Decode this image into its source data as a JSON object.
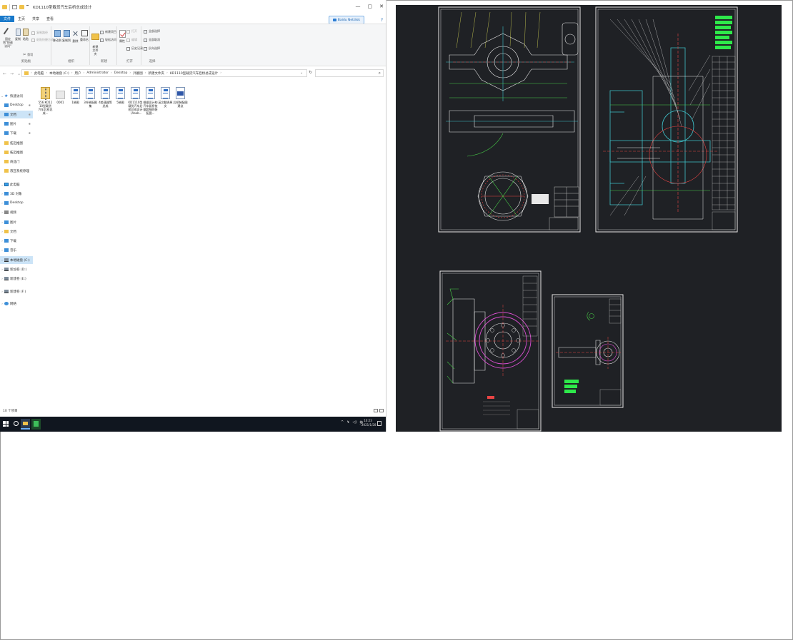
{
  "window": {
    "title": "KD1110型载货汽车后桥总成设计",
    "minimize": "—",
    "maximize": "▢",
    "close": "✕"
  },
  "ribbon": {
    "tabs": [
      "文件",
      "主页",
      "共享",
      "查看"
    ],
    "share_button": "Baidu Netdisk",
    "help": "?",
    "groups": {
      "clipboard": {
        "label": "剪贴板",
        "pin": "固定到\"快速访问\"",
        "copy": "复制",
        "paste": "粘贴",
        "copy_path": "复制路径",
        "paste_shortcut": "粘贴快捷方式",
        "cut": "剪切"
      },
      "organize": {
        "label": "组织",
        "move_to": "移动到",
        "copy_to": "复制到",
        "delete": "删除",
        "rename": "重命名"
      },
      "new": {
        "label": "新建",
        "new_folder": "新建\n文件夹",
        "new_item": "新建项目",
        "easy_access": "轻松访问"
      },
      "open": {
        "label": "打开",
        "properties": "属性",
        "open": "打开",
        "edit": "编辑",
        "history": "历史记录"
      },
      "select": {
        "label": "选择",
        "select_all": "全部选择",
        "select_none": "全部取消",
        "invert": "反向选择"
      }
    }
  },
  "address": {
    "back": "←",
    "forward": "→",
    "recent": "⌄",
    "up": "↑",
    "crumbs": [
      "此电脑",
      "本地磁盘 (C:)",
      "用户",
      "Administrator",
      "Desktop",
      "外翻图",
      "新建文件夹",
      "KD1110型载货汽车后桥总成设计"
    ],
    "separator": "›",
    "dropdown": "⌄",
    "refresh": "↻",
    "search_icon": "⌕"
  },
  "navpane": {
    "items": [
      {
        "label": "快速访问",
        "icon": "star-icon",
        "kind": "star",
        "chev": "⌄",
        "pin": ""
      },
      {
        "label": "Desktop",
        "icon": "desktop-icon",
        "kind": "blue",
        "chev": "",
        "pin": "✱"
      },
      {
        "label": "文档",
        "icon": "documents-icon",
        "kind": "blue",
        "chev": "",
        "pin": "✱"
      },
      {
        "label": "图片",
        "icon": "pictures-icon",
        "kind": "blue",
        "chev": "",
        "pin": "✱"
      },
      {
        "label": "下载",
        "icon": "downloads-icon",
        "kind": "blue",
        "chev": "",
        "pin": "✱"
      },
      {
        "label": "拓迈推图",
        "icon": "folder-icon",
        "kind": "yellow",
        "chev": "",
        "pin": ""
      },
      {
        "label": "拓迈推图",
        "icon": "folder-icon",
        "kind": "yellow",
        "chev": "",
        "pin": ""
      },
      {
        "label": "商品门",
        "icon": "folder-icon",
        "kind": "yellow",
        "chev": "",
        "pin": ""
      },
      {
        "label": "液压系统原理",
        "icon": "folder-icon",
        "kind": "yellow",
        "chev": "",
        "pin": ""
      },
      {
        "label": "此电脑",
        "icon": "computer-icon",
        "kind": "pc",
        "chev": "⌄",
        "pin": ""
      },
      {
        "label": "3D 对象",
        "icon": "3d-objects-icon",
        "kind": "blue",
        "chev": "›",
        "pin": ""
      },
      {
        "label": "Desktop",
        "icon": "desktop-icon",
        "kind": "blue",
        "chev": "›",
        "pin": ""
      },
      {
        "label": "视频",
        "icon": "videos-icon",
        "kind": "gray",
        "chev": "›",
        "pin": ""
      },
      {
        "label": "图片",
        "icon": "pictures-icon",
        "kind": "blue",
        "chev": "›",
        "pin": ""
      },
      {
        "label": "文档",
        "icon": "documents-icon",
        "kind": "yellow",
        "chev": "›",
        "pin": ""
      },
      {
        "label": "下载",
        "icon": "downloads-icon",
        "kind": "blue",
        "chev": "›",
        "pin": ""
      },
      {
        "label": "音乐",
        "icon": "music-icon",
        "kind": "blue",
        "chev": "›",
        "pin": ""
      },
      {
        "label": "本地磁盘 (C:)",
        "icon": "drive-icon",
        "kind": "drive",
        "chev": "›",
        "pin": ""
      },
      {
        "label": "新加卷 (D:)",
        "icon": "drive-icon",
        "kind": "drive",
        "chev": "›",
        "pin": ""
      },
      {
        "label": "新建卷 (E:)",
        "icon": "drive-icon",
        "kind": "drive",
        "chev": "›",
        "pin": ""
      },
      {
        "label": "新建卷 (F:)",
        "icon": "drive-icon",
        "kind": "drive",
        "chev": "›",
        "pin": ""
      },
      {
        "label": "网络",
        "icon": "network-icon",
        "kind": "net",
        "chev": "›",
        "pin": ""
      }
    ]
  },
  "files": [
    {
      "name": "556 KD1110型载货汽车后桥总成...",
      "type": "zip"
    },
    {
      "name": "0001",
      "type": "blank"
    },
    {
      "name": "1装图",
      "type": "doc"
    },
    {
      "name": "3外装配图集",
      "type": "doc"
    },
    {
      "name": "4差速器等总成",
      "type": "doc"
    },
    {
      "name": "5装图",
      "type": "doc"
    },
    {
      "name": "KD1110型载货汽车后桥总成设计（Aeob...",
      "type": "doc"
    },
    {
      "name": "根据设计构汽车驱桥依据超细的装配图...",
      "type": "doc"
    },
    {
      "name": "英文翻译原文",
      "type": "doc"
    },
    {
      "name": "后桥装配图建议",
      "type": "dwg"
    }
  ],
  "statusbar": {
    "count": "10 个项目"
  },
  "taskbar": {
    "tray": [
      "^",
      "↯",
      "◁)",
      "英"
    ],
    "time": "10:23",
    "date": "2021/1/28"
  }
}
